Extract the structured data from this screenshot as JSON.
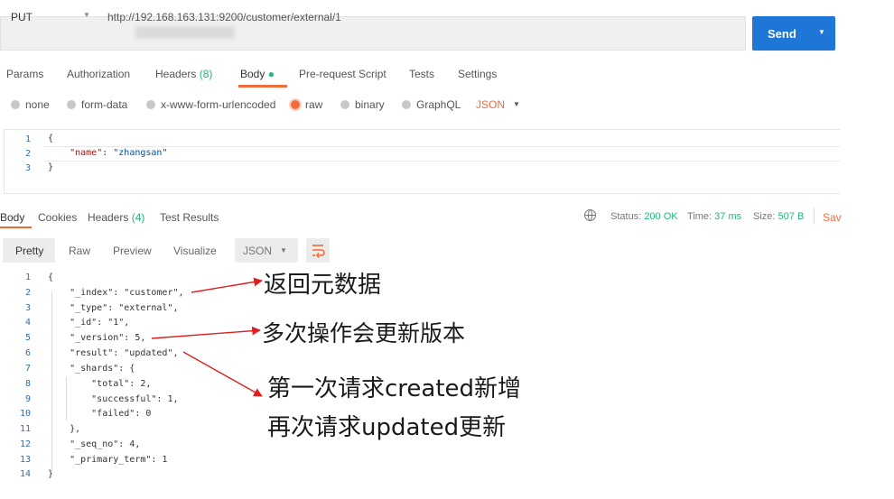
{
  "request": {
    "method": "PUT",
    "url": "http://192.168.163.131:9200/customer/external/1",
    "send_label": "Send"
  },
  "request_tabs": [
    {
      "label": "Params"
    },
    {
      "label": "Authorization"
    },
    {
      "label": "Headers",
      "count": "(8)"
    },
    {
      "label": "Body",
      "active": true
    },
    {
      "label": "Pre-request Script"
    },
    {
      "label": "Tests"
    },
    {
      "label": "Settings"
    }
  ],
  "body_types": [
    {
      "label": "none"
    },
    {
      "label": "form-data"
    },
    {
      "label": "x-www-form-urlencoded"
    },
    {
      "label": "raw",
      "selected": true
    },
    {
      "label": "binary"
    },
    {
      "label": "GraphQL"
    }
  ],
  "body_format": "JSON",
  "request_body": {
    "line_numbers": [
      "1",
      "2",
      "3"
    ],
    "lines": [
      "{",
      "    \"name\": \"zhangsan\"",
      "}"
    ],
    "key": "\"name\"",
    "value": "\"zhangsan\""
  },
  "response_tabs": [
    {
      "label": "Body",
      "active": true
    },
    {
      "label": "Cookies"
    },
    {
      "label": "Headers",
      "count": "(4)"
    },
    {
      "label": "Test Results"
    }
  ],
  "response_status": {
    "status_label": "Status:",
    "status_value": "200 OK",
    "time_label": "Time:",
    "time_value": "37 ms",
    "size_label": "Size:",
    "size_value": "507 B",
    "save_label": "Sav"
  },
  "view_modes": [
    "Pretty",
    "Raw",
    "Preview",
    "Visualize"
  ],
  "response_format": "JSON",
  "response_body": {
    "line_numbers": [
      "1",
      "2",
      "3",
      "4",
      "5",
      "6",
      "7",
      "8",
      "9",
      "10",
      "11",
      "12",
      "13",
      "14"
    ],
    "lines": [
      "{",
      "    \"_index\": \"customer\",",
      "    \"_type\": \"external\",",
      "    \"_id\": \"1\",",
      "    \"_version\": 5,",
      "    \"result\": \"updated\",",
      "    \"_shards\": {",
      "        \"total\": 2,",
      "        \"successful\": 1,",
      "        \"failed\": 0",
      "    },",
      "    \"_seq_no\": 4,",
      "    \"_primary_term\": 1",
      "}"
    ]
  },
  "annotations": {
    "meta": "返回元数据",
    "version": "多次操作会更新版本",
    "created": "第一次请求created新增",
    "updated": "再次请求updated更新"
  },
  "colors": {
    "accent": "#f26b3a",
    "send": "#1e76d6",
    "success": "#26b47f"
  }
}
